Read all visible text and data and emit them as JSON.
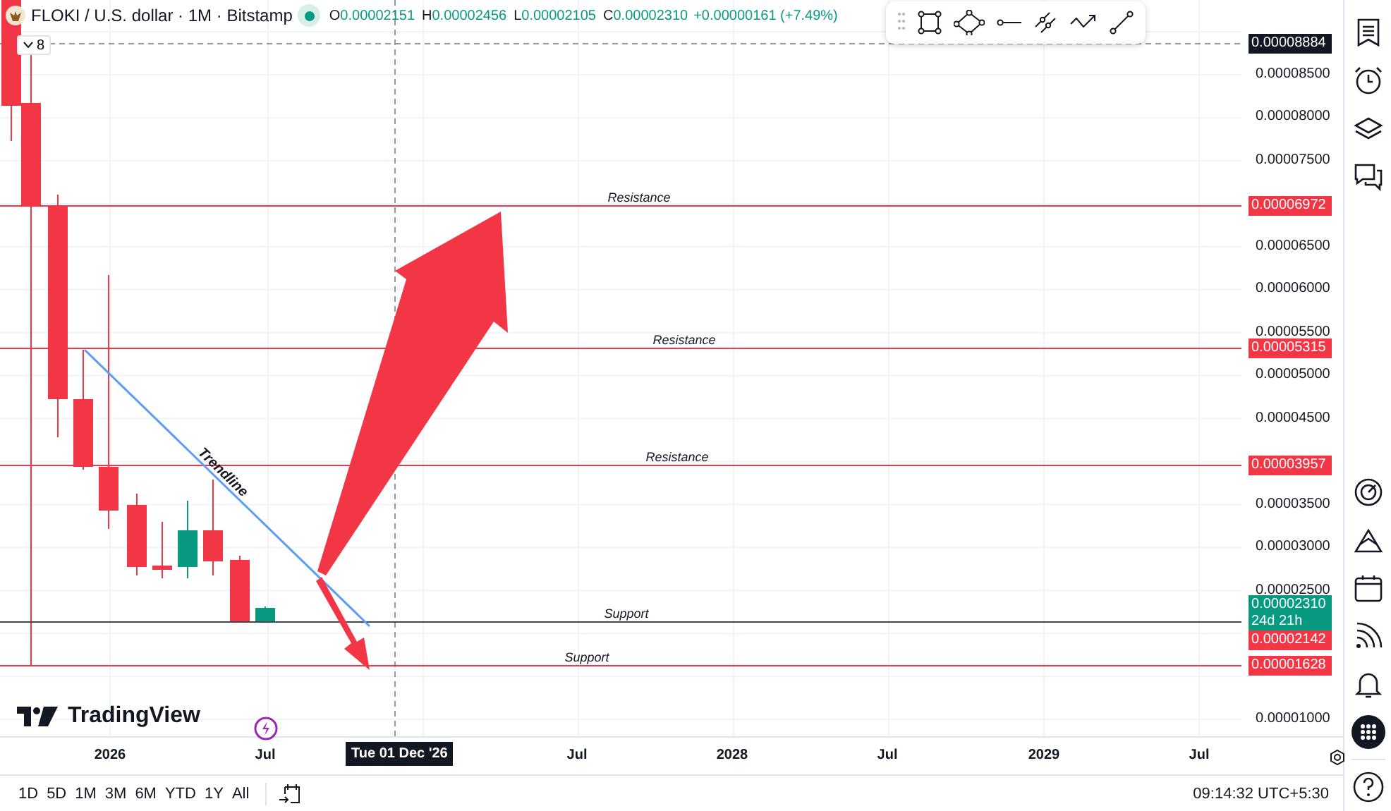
{
  "header": {
    "symbol": "FLOKI / U.S. dollar · 1M · Bitstamp",
    "market_open": true,
    "ohlc": [
      {
        "label": "O",
        "value": "0.00002151"
      },
      {
        "label": "H",
        "value": "0.00002456"
      },
      {
        "label": "L",
        "value": "0.00002105"
      },
      {
        "label": "C",
        "value": "0.00002310"
      }
    ],
    "change": "+0.00000161 (+7.49%)",
    "indicator_count": "8"
  },
  "drawings": [
    {
      "kind": "horizontal",
      "label": "Resistance",
      "color": "#f23645"
    },
    {
      "kind": "horizontal",
      "label": "Resistance",
      "color": "#f23645"
    },
    {
      "kind": "horizontal",
      "label": "Resistance",
      "color": "#f23645"
    },
    {
      "kind": "horizontal",
      "label": "Support",
      "color": "#434651"
    },
    {
      "kind": "horizontal",
      "label": "Support",
      "color": "#f23645"
    },
    {
      "kind": "trendline",
      "label": "Trendline",
      "color": "#5b9cf6"
    }
  ],
  "price_axis": {
    "ticks": [
      "0.00008500",
      "0.00008000",
      "0.00007500",
      "0.00006500",
      "0.00006000",
      "0.00005500",
      "0.00005000",
      "0.00004500",
      "0.00003500",
      "0.00003000",
      "0.00002500",
      "0.00001000"
    ],
    "markers": [
      {
        "kind": "crosshair",
        "text": "0.00008884",
        "color": "#131722"
      },
      {
        "kind": "line",
        "text": "0.00006972",
        "color": "#f23645"
      },
      {
        "kind": "line",
        "text": "0.00005315",
        "color": "#f23645"
      },
      {
        "kind": "line",
        "text": "0.00003957",
        "color": "#f23645"
      },
      {
        "kind": "last",
        "text": "0.00002310",
        "countdown": "24d 21h",
        "color": "#089981"
      },
      {
        "kind": "line",
        "text": "0.00002142",
        "color": "#f23645"
      },
      {
        "kind": "line",
        "text": "0.00001628",
        "color": "#f23645"
      }
    ]
  },
  "logo": "TradingView",
  "time_axis": {
    "ticks": [
      "2026",
      "Jul",
      "Jul",
      "2028",
      "Jul",
      "2029",
      "Jul"
    ],
    "crosshair": "Tue 01 Dec '26"
  },
  "ranges": [
    {
      "label": "1D",
      "selected": false
    },
    {
      "label": "5D",
      "selected": false
    },
    {
      "label": "1M",
      "selected": false
    },
    {
      "label": "3M",
      "selected": false
    },
    {
      "label": "6M",
      "selected": false
    },
    {
      "label": "YTD",
      "selected": false
    },
    {
      "label": "1Y",
      "selected": false
    },
    {
      "label": "All",
      "selected": false
    }
  ],
  "clock": "09:14:32 UTC+5:30"
}
